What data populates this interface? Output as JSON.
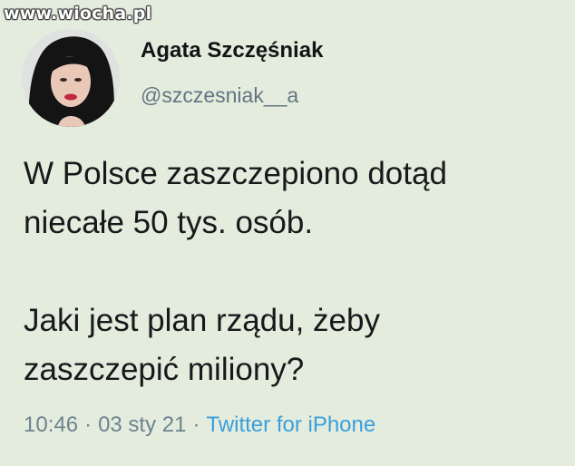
{
  "watermark": "www.wiocha.pl",
  "author": {
    "display_name": "Agata Szczęśniak",
    "handle": "@szczesniak__a"
  },
  "tweet": {
    "paragraph_1": [
      "W Polsce zaszczepiono dotąd",
      "niecałe 50 tys. osób."
    ],
    "paragraph_2": [
      "Jaki jest plan rządu, żeby",
      "zaszczepić miliony?"
    ]
  },
  "meta": {
    "time": "10:46",
    "separator": "·",
    "date": "03 sty 21",
    "source": "Twitter for iPhone"
  },
  "colors": {
    "background": "#e4ecdd",
    "text": "#17191b",
    "handle": "#617582",
    "source_link": "#3a9fdc"
  }
}
